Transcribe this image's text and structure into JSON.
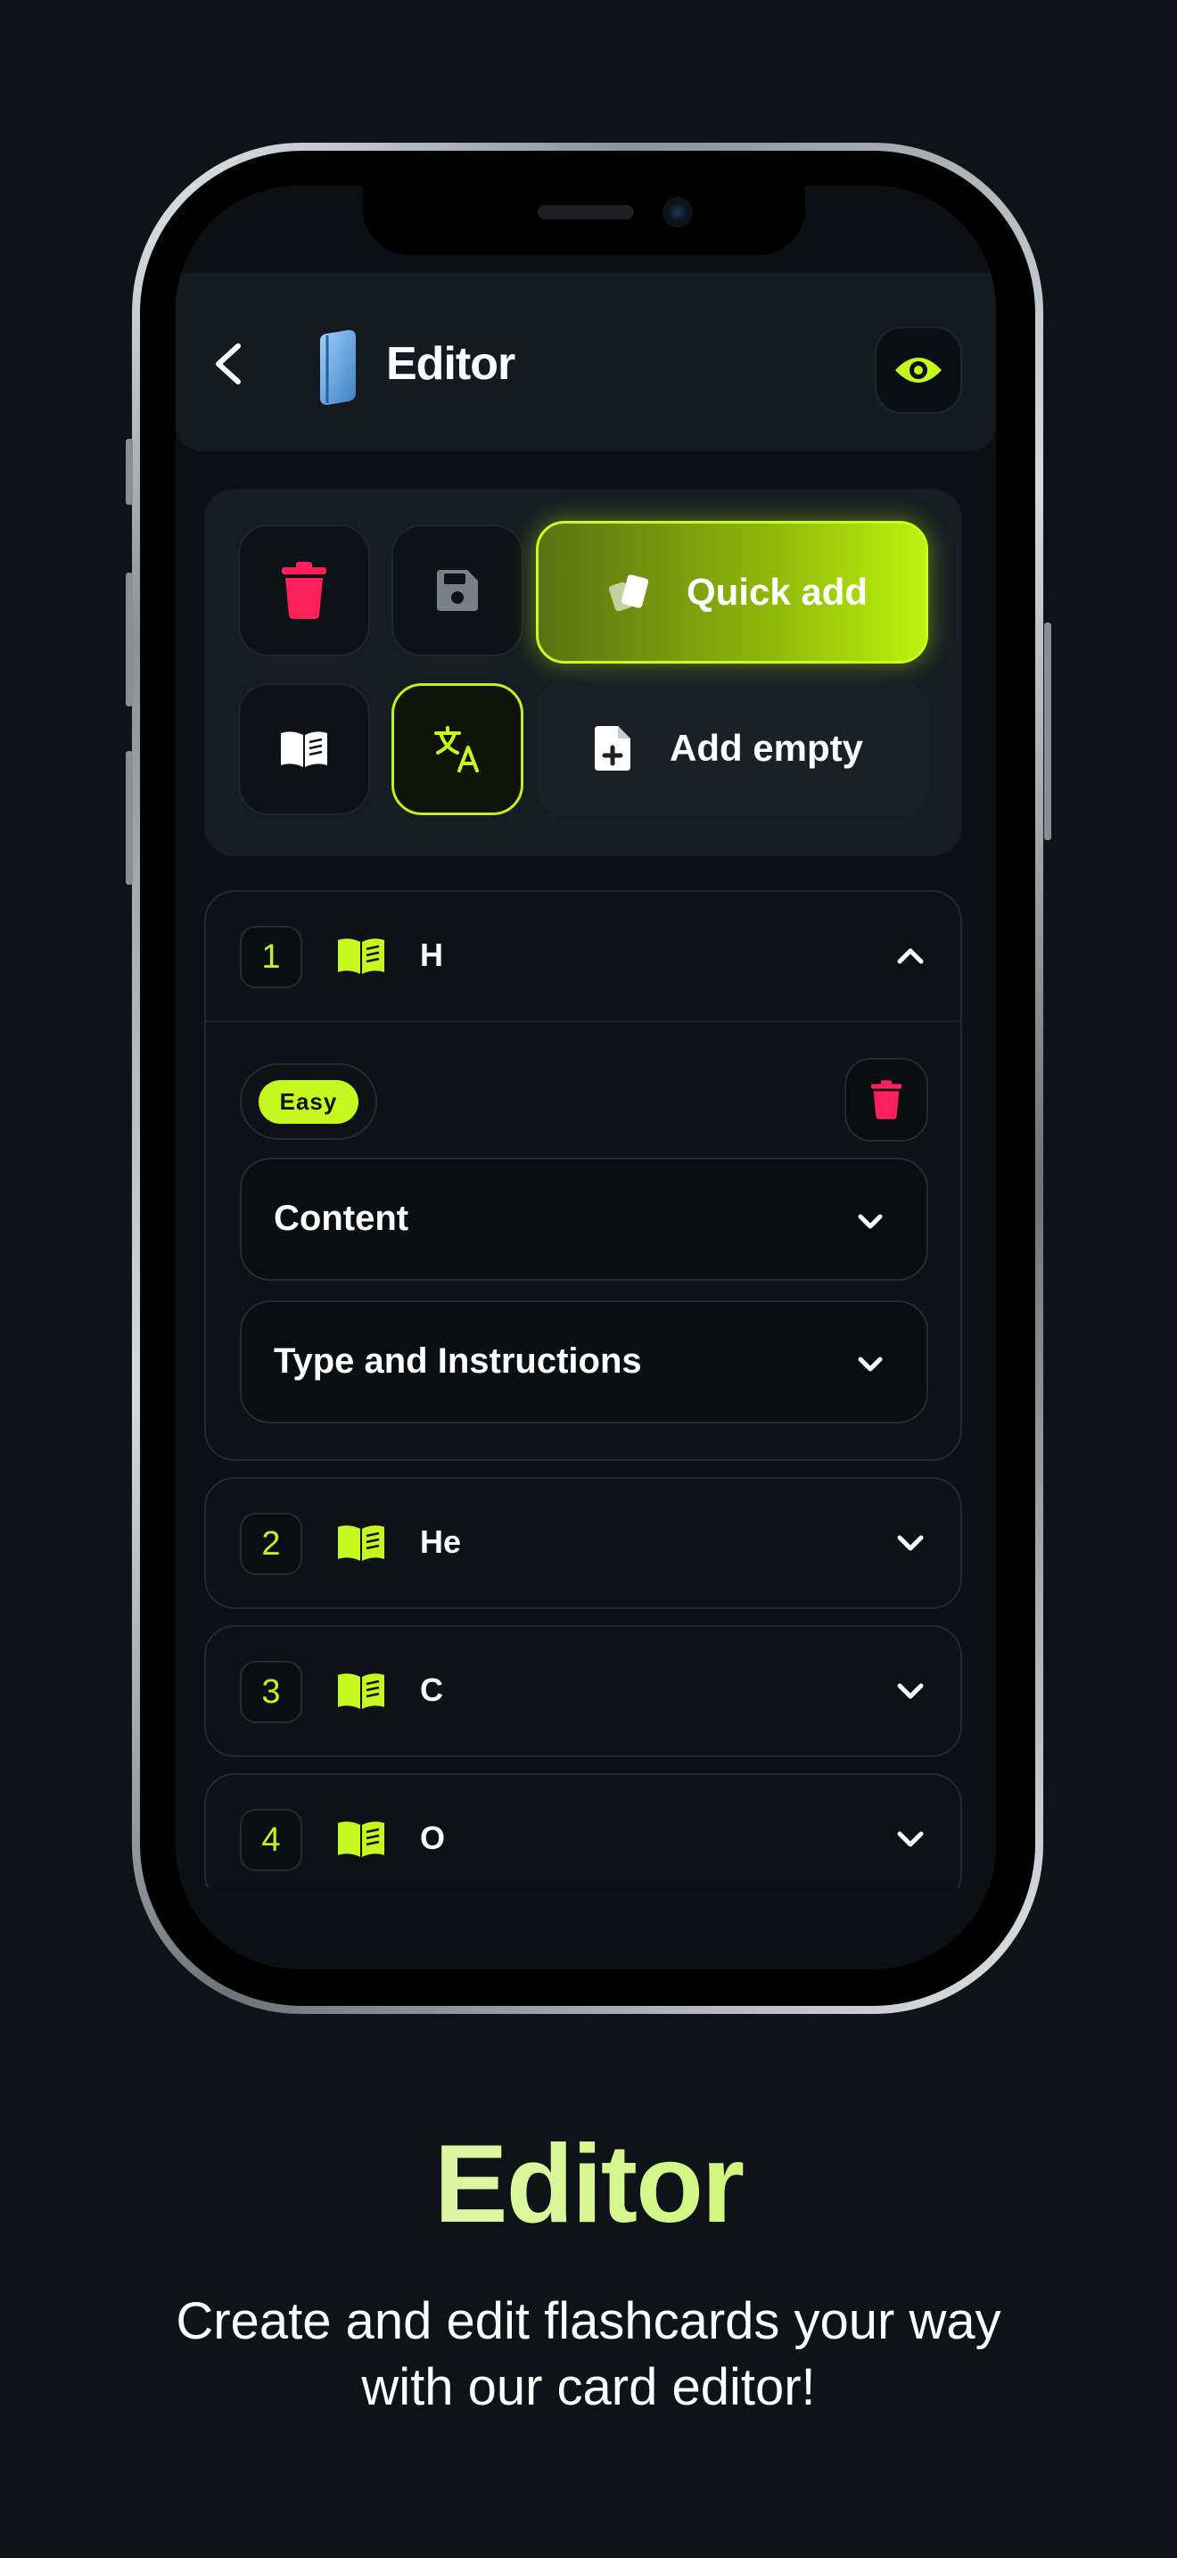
{
  "header": {
    "title": "Editor"
  },
  "toolbar": {
    "quick_add_label": "Quick add",
    "add_empty_label": "Add empty"
  },
  "cards": [
    {
      "number": "1",
      "name": "H",
      "expanded": true,
      "difficulty": "Easy",
      "sections": [
        "Content",
        "Type and Instructions"
      ]
    },
    {
      "number": "2",
      "name": "He",
      "expanded": false
    },
    {
      "number": "3",
      "name": "C",
      "expanded": false
    },
    {
      "number": "4",
      "name": "O",
      "expanded": false
    }
  ],
  "promo": {
    "title": "Editor",
    "subtitle_line1": "Create and edit flashcards your way",
    "subtitle_line2": "with our card editor!"
  },
  "colors": {
    "accent": "#c4f81e",
    "danger": "#ff1f5a",
    "background": "#0f1317"
  },
  "icons": [
    "back-chevron-icon",
    "book-logo-icon",
    "eye-icon",
    "trash-icon",
    "floppy-disk-icon",
    "open-book-icon",
    "translate-icon",
    "cards-icon",
    "file-plus-icon",
    "chevron-up-icon",
    "chevron-down-icon"
  ]
}
